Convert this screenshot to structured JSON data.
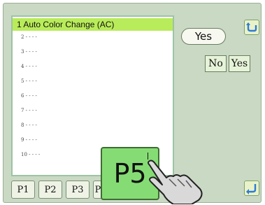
{
  "list": {
    "rows": [
      {
        "label": "1 Auto Color Change (AC)"
      },
      {
        "label": "2 - - - -"
      },
      {
        "label": "3 - - - -"
      },
      {
        "label": "4 - - - -"
      },
      {
        "label": "5 - - - -"
      },
      {
        "label": "6 - - - -"
      },
      {
        "label": "7 - - - -"
      },
      {
        "label": "8 - - - -"
      },
      {
        "label": "9 - - - -"
      },
      {
        "label": "10 - - - -"
      }
    ]
  },
  "selected_value": "Yes",
  "options": {
    "no": "No",
    "yes": "Yes"
  },
  "tabs": [
    "P1",
    "P2",
    "P3",
    "P"
  ],
  "active_tab_popup": "P5",
  "icons": {
    "return_top": "return-arrow-icon",
    "return_bottom": "return-arrow-icon",
    "hand": "pointing-hand-icon"
  },
  "colors": {
    "panel": "#c9d9c4",
    "highlight": "#b9ec5a",
    "popup": "#86dc74",
    "icon_arrow": "#f0d24a"
  }
}
